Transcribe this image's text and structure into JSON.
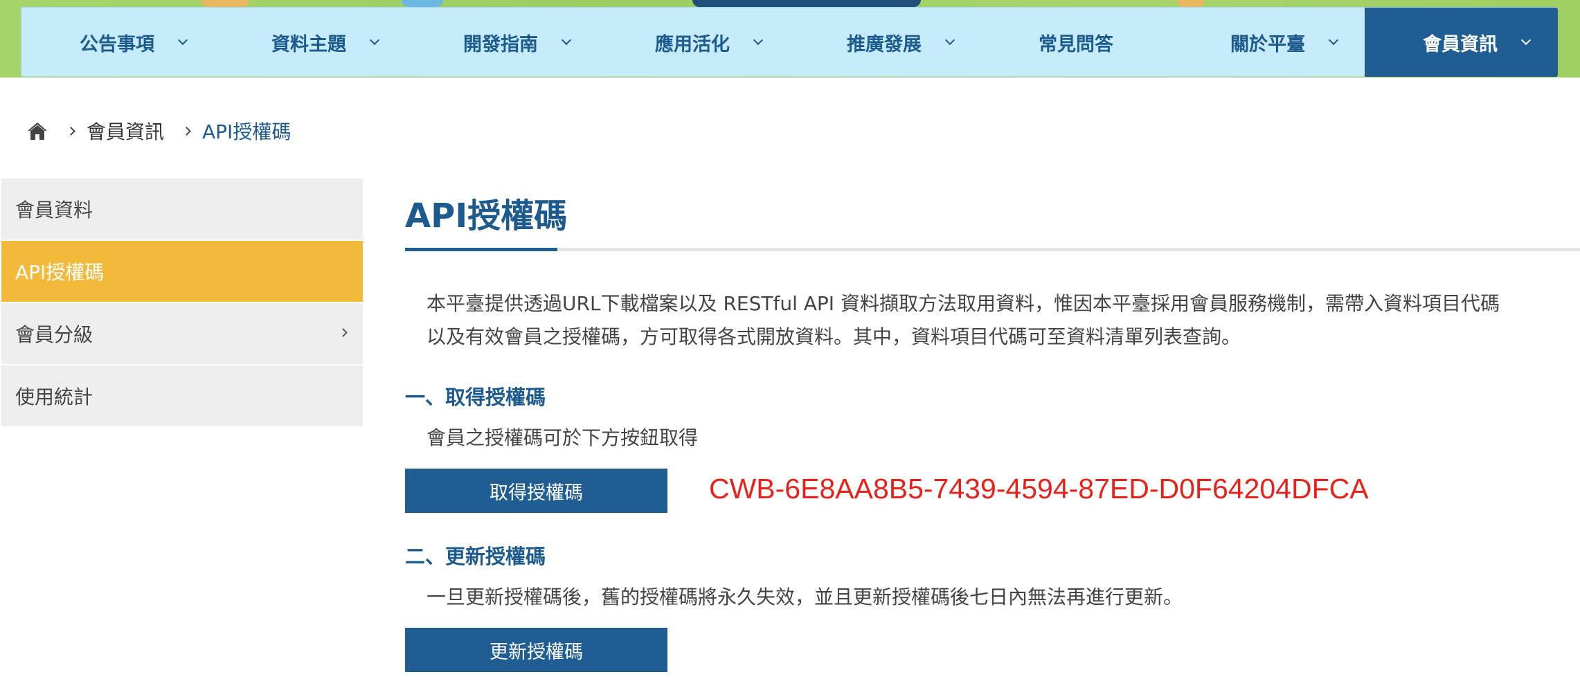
{
  "nav": {
    "items": [
      {
        "label": "公告事項",
        "has_dropdown": true
      },
      {
        "label": "資料主題",
        "has_dropdown": true
      },
      {
        "label": "開發指南",
        "has_dropdown": true
      },
      {
        "label": "應用活化",
        "has_dropdown": true
      },
      {
        "label": "推廣發展",
        "has_dropdown": true
      },
      {
        "label": "常見問答",
        "has_dropdown": false
      },
      {
        "label": "關於平臺",
        "has_dropdown": true
      },
      {
        "label": "會員資訊",
        "has_dropdown": true,
        "active": true
      }
    ]
  },
  "breadcrumb": {
    "home_icon": "home-icon",
    "items": [
      "會員資訊",
      "API授權碼"
    ]
  },
  "sidebar": {
    "items": [
      {
        "label": "會員資料"
      },
      {
        "label": "API授權碼",
        "active": true
      },
      {
        "label": "會員分級",
        "has_submenu": true
      },
      {
        "label": "使用統計"
      }
    ]
  },
  "main": {
    "title": "API授權碼",
    "intro_line1": "本平臺提供透過URL下載檔案以及 RESTful API 資料擷取方法取用資料，惟因本平臺採用會員服務機制，需帶入資料項目代碼",
    "intro_line2": "以及有效會員之授權碼，方可取得各式開放資料。其中，資料項目代碼可至資料清單列表查詢。",
    "section1": {
      "heading": "一、取得授權碼",
      "text": "會員之授權碼可於下方按鈕取得",
      "button": "取得授權碼",
      "auth_code": "CWB-6E8AA8B5-7439-4594-87ED-D0F64204DFCA"
    },
    "section2": {
      "heading": "二、更新授權碼",
      "text": "一旦更新授權碼後，舊的授權碼將永久失效，並且更新授權碼後七日內無法再進行更新。",
      "button": "更新授權碼"
    }
  },
  "colors": {
    "nav_bg": "#c6ecfb",
    "nav_text": "#1d5a8e",
    "nav_active_bg": "#1f5d93",
    "sidebar_active_bg": "#f2b93b",
    "button_bg": "#1f5d93",
    "auth_code_color": "#e8221b"
  }
}
